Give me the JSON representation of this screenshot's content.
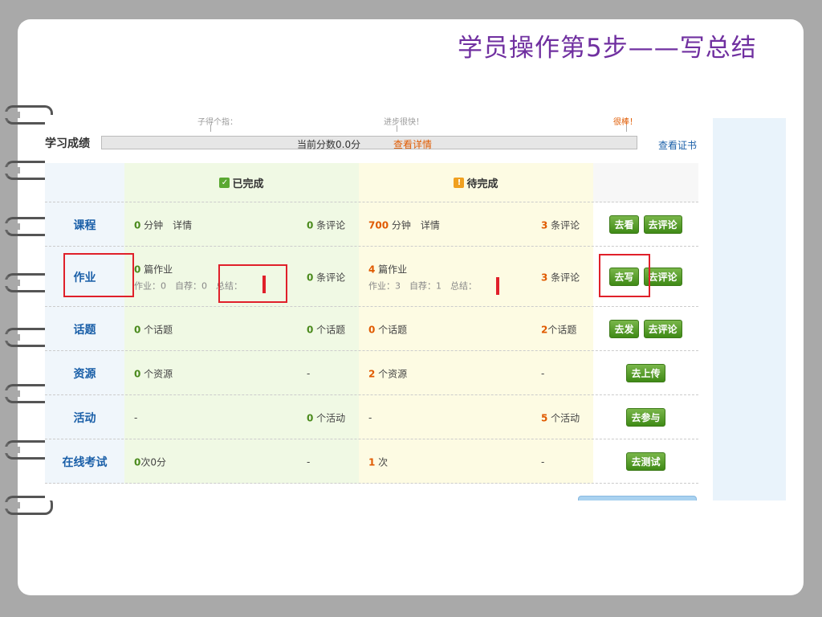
{
  "slide": {
    "title": "学员操作第5步——写总结"
  },
  "progress_labels": [
    "子得个指：",
    "进步很快！",
    "很棒！"
  ],
  "score": {
    "label": "学习成绩",
    "current": "当前分数0.0分",
    "details_link": "查看详情",
    "cert_link": "查看证书"
  },
  "table": {
    "header_done": "已完成",
    "header_todo": "待完成",
    "rows": [
      {
        "name": "课程",
        "done_num": "0",
        "done_text": " 分钟　详情",
        "done_count_num": "0",
        "done_count_text": " 条评论",
        "todo_num": "700",
        "todo_text": " 分钟　详情",
        "todo_count_num": "3",
        "todo_count_text": " 条评论",
        "actions": [
          "去看",
          "去评论"
        ]
      },
      {
        "name": "作业",
        "done_num": "0",
        "done_text": " 篇作业",
        "done_sub": "作业：0　自荐：0　总结：",
        "done_count_num": "0",
        "done_count_text": " 条评论",
        "todo_num": "4",
        "todo_text": " 篇作业",
        "todo_sub": "作业：3　自荐：1　总结：",
        "todo_count_num": "3",
        "todo_count_text": " 条评论",
        "actions": [
          "去写",
          "去评论"
        ]
      },
      {
        "name": "话题",
        "done_num": "0",
        "done_text": " 个话题",
        "done_count_num": "0",
        "done_count_text": " 个话题",
        "todo_num": "0",
        "todo_text": " 个话题",
        "todo_count_num": "2",
        "todo_count_text": "个话题",
        "actions": [
          "去发",
          "去评论"
        ]
      },
      {
        "name": "资源",
        "done_num": "0",
        "done_text": " 个资源",
        "done_count_num": "",
        "done_count_text": "-",
        "todo_num": "2",
        "todo_text": " 个资源",
        "todo_count_num": "",
        "todo_count_text": "-",
        "actions": [
          "去上传"
        ]
      },
      {
        "name": "活动",
        "done_num": "",
        "done_text": "-",
        "done_count_num": "0",
        "done_count_text": " 个活动",
        "todo_num": "",
        "todo_text": "-",
        "todo_count_num": "5",
        "todo_count_text": " 个活动",
        "actions": [
          "去参与"
        ]
      },
      {
        "name": "在线考试",
        "done_num": "0",
        "done_text": "次0分",
        "done_count_num": "",
        "done_count_text": "-",
        "todo_num": "1",
        "todo_text": " 次",
        "todo_count_num": "",
        "todo_count_text": "-",
        "actions": [
          "去测试"
        ]
      }
    ]
  },
  "colors": {
    "title": "#7030a0",
    "highlight": "#e0202a",
    "button": "#4a9a22",
    "link": "#1a5fa8"
  }
}
